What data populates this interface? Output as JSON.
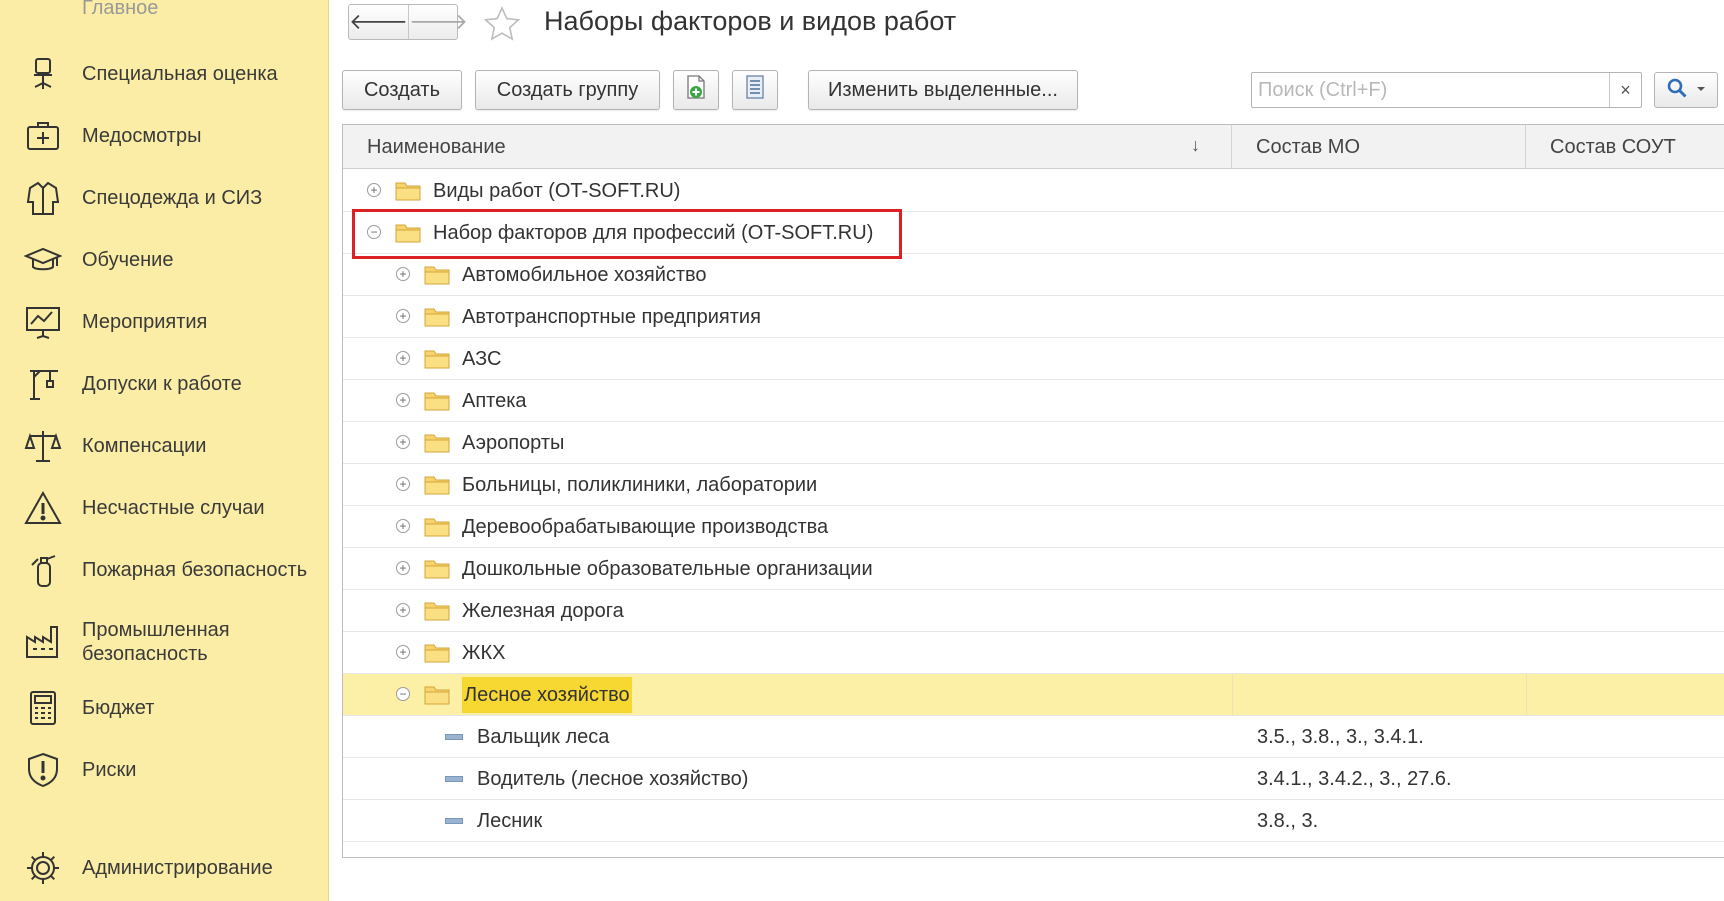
{
  "sidebar": {
    "items": [
      {
        "label": "Главное",
        "icon": "home-icon"
      },
      {
        "label": "Специальная оценка",
        "icon": "office-chair-icon"
      },
      {
        "label": "Медосмотры",
        "icon": "first-aid-kit-icon"
      },
      {
        "label": "Спецодежда и СИЗ",
        "icon": "jacket-icon"
      },
      {
        "label": "Обучение",
        "icon": "graduation-cap-icon"
      },
      {
        "label": "Мероприятия",
        "icon": "presentation-board-icon"
      },
      {
        "label": "Допуски к работе",
        "icon": "crane-icon"
      },
      {
        "label": "Компенсации",
        "icon": "scales-icon"
      },
      {
        "label": "Несчастные случаи",
        "icon": "warning-triangle-icon"
      },
      {
        "label": "Пожарная безопасность",
        "icon": "fire-extinguisher-icon"
      },
      {
        "label": "Промышленная безопасность",
        "icon": "factory-icon"
      },
      {
        "label": "Бюджет",
        "icon": "calculator-icon"
      },
      {
        "label": "Риски",
        "icon": "shield-exclamation-icon"
      },
      {
        "label": "Администрирование",
        "icon": "gear-icon"
      }
    ]
  },
  "header": {
    "back": "🡐",
    "forward": "🡒",
    "title": "Наборы факторов и видов работ"
  },
  "toolbar": {
    "create": "Создать",
    "create_group": "Создать группу",
    "change_selected": "Изменить выделенные...",
    "search_placeholder": "Поиск (Ctrl+F)",
    "clear": "×"
  },
  "table": {
    "columns": [
      "Наименование",
      "Состав МО",
      "Состав СОУТ"
    ],
    "sort_indicator": "↓",
    "rows": [
      {
        "name": "Виды работ (OT-SOFT.RU)",
        "level": 0,
        "type": "folder",
        "state": "+",
        "mo": ""
      },
      {
        "name": "Набор факторов для профессий (OT-SOFT.RU)",
        "level": 0,
        "type": "folder",
        "state": "−",
        "mo": ""
      },
      {
        "name": "Автомобильное хозяйство",
        "level": 1,
        "type": "folder",
        "state": "+",
        "mo": ""
      },
      {
        "name": "Автотранспортные предприятия",
        "level": 1,
        "type": "folder",
        "state": "+",
        "mo": ""
      },
      {
        "name": "АЗС",
        "level": 1,
        "type": "folder",
        "state": "+",
        "mo": ""
      },
      {
        "name": "Аптека",
        "level": 1,
        "type": "folder",
        "state": "+",
        "mo": ""
      },
      {
        "name": "Аэропорты",
        "level": 1,
        "type": "folder",
        "state": "+",
        "mo": ""
      },
      {
        "name": "Больницы, поликлиники, лаборатории",
        "level": 1,
        "type": "folder",
        "state": "+",
        "mo": ""
      },
      {
        "name": "Деревообрабатывающие производства",
        "level": 1,
        "type": "folder",
        "state": "+",
        "mo": ""
      },
      {
        "name": "Дошкольные образовательные организации",
        "level": 1,
        "type": "folder",
        "state": "+",
        "mo": ""
      },
      {
        "name": "Железная дорога",
        "level": 1,
        "type": "folder",
        "state": "+",
        "mo": ""
      },
      {
        "name": "ЖКХ",
        "level": 1,
        "type": "folder",
        "state": "+",
        "mo": ""
      },
      {
        "name": "Лесное хозяйство",
        "level": 1,
        "type": "folder",
        "state": "−",
        "mo": "",
        "selected": true
      },
      {
        "name": "Вальщик леса",
        "level": 2,
        "type": "item",
        "mo": "3.5., 3.8., 3., 3.4.1."
      },
      {
        "name": "Водитель (лесное хозяйство)",
        "level": 2,
        "type": "item",
        "mo": "3.4.1., 3.4.2., 3., 27.6."
      },
      {
        "name": "Лесник",
        "level": 2,
        "type": "item",
        "mo": "3.8., 3."
      }
    ]
  },
  "colors": {
    "sidebar_bg": "#fbeda5",
    "selected_row": "#fcefa6",
    "highlight": "#f7d731",
    "annotation_box": "#dd1f26"
  }
}
